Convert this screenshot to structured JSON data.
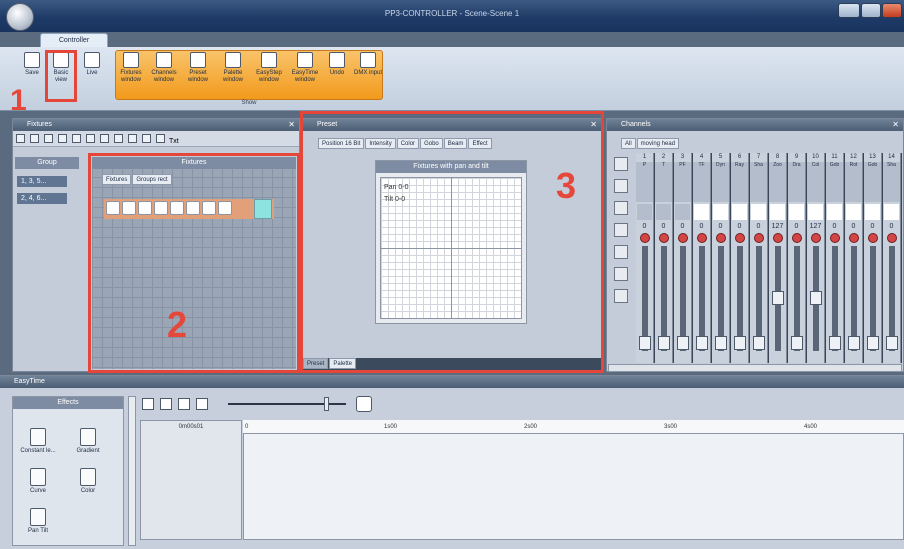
{
  "window": {
    "title": "PP3-CONTROLLER",
    "scene": "Scene-Scene 1"
  },
  "ribbon": {
    "tab": "Controller",
    "buttons": [
      {
        "label": "Save",
        "icon": "save-icon"
      },
      {
        "label": "Basic view",
        "icon": "basic-view-icon"
      },
      {
        "label": "Live",
        "icon": "live-icon"
      },
      {
        "label": "Fixtures window",
        "icon": "fixtures-window-icon"
      },
      {
        "label": "Channels window",
        "icon": "channels-window-icon"
      },
      {
        "label": "Preset window",
        "icon": "preset-window-icon"
      },
      {
        "label": "Palette window",
        "icon": "palette-window-icon"
      },
      {
        "label": "EasyStep window",
        "icon": "easystep-window-icon"
      },
      {
        "label": "EasyTime window",
        "icon": "easytime-window-icon"
      },
      {
        "label": "Undo",
        "icon": "undo-icon"
      },
      {
        "label": "DMX input",
        "icon": "dmx-input-icon"
      }
    ],
    "group_label": "Show"
  },
  "fixtures_panel": {
    "title": "Fixtures",
    "group_header": "Group",
    "groups": [
      "1, 3, 5...",
      "2, 4, 6..."
    ],
    "fixtures_header": "Fixtures",
    "tabs": [
      "Fixtures",
      "Groups rect"
    ],
    "txt_label": "Txt",
    "fixture_count": 8
  },
  "preset_panel": {
    "title": "Preset",
    "tabs": [
      "Position 16 Bit",
      "Intensity",
      "Color",
      "Gobo",
      "Beam",
      "Effect"
    ],
    "plot_title": "Fixtures with pan and tilt",
    "pan": "Pan 0-0",
    "tilt": "Tilt 0-0",
    "bottom_tabs": [
      "Preset",
      "Palette"
    ]
  },
  "channels_panel": {
    "title": "Channels",
    "tabs": [
      "All",
      "moving head"
    ],
    "channel_numbers": [
      "1",
      "2",
      "3",
      "4",
      "5",
      "6",
      "7",
      "8",
      "9",
      "10",
      "11",
      "12",
      "13",
      "14"
    ],
    "channel_names": [
      "P",
      "T",
      "PF",
      "TF",
      "Dyn",
      "Ray",
      "Sha",
      "Zoo",
      "Dra",
      "Col",
      "Gob",
      "Rot",
      "Gob",
      "Sha"
    ],
    "values": [
      "0",
      "0",
      "0",
      "0",
      "0",
      "0",
      "0",
      "127",
      "0",
      "127",
      "0",
      "0",
      "0",
      "0"
    ]
  },
  "easytime_panel": {
    "title": "EasyTime",
    "effects_header": "Effects",
    "effects": [
      "Constant le...",
      "Gradient",
      "Curve",
      "Color",
      "Pan Tilt"
    ],
    "time_start": "0m00s01",
    "ruler": [
      "0",
      "1s00",
      "2s00",
      "3s00",
      "4s00"
    ]
  },
  "annotations": [
    "1",
    "2",
    "3"
  ]
}
